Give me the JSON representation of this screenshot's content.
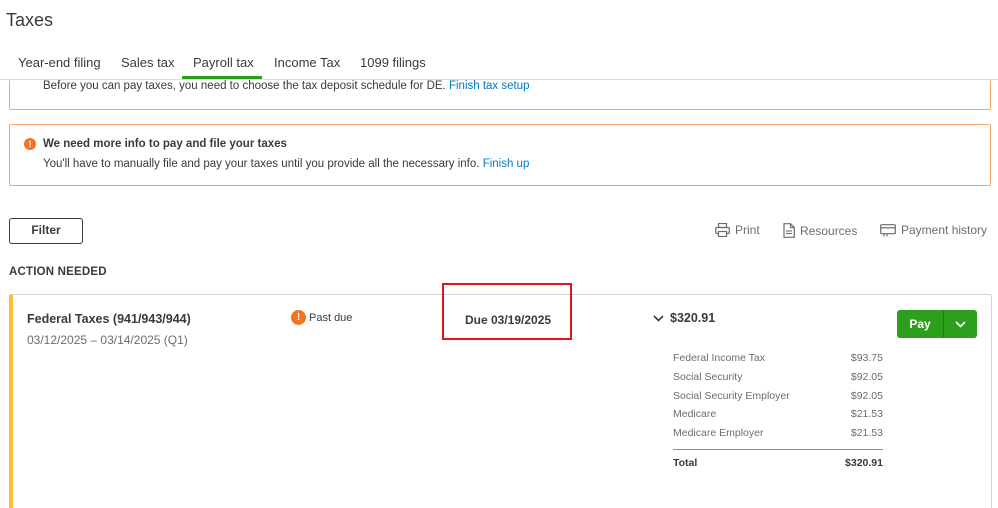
{
  "page": {
    "title": "Taxes"
  },
  "tabs": [
    {
      "label": "Year-end filing"
    },
    {
      "label": "Sales tax"
    },
    {
      "label": "Payroll tax"
    },
    {
      "label": "Income Tax"
    },
    {
      "label": "1099 filings"
    }
  ],
  "active_tab": "Payroll tax",
  "banner_deposit": {
    "text": "Before you can pay taxes, you need to choose the tax deposit schedule for DE.",
    "link": "Finish tax setup"
  },
  "banner_info": {
    "title": "We need more info to pay and file your taxes",
    "text": "You'll have to manually file and pay your taxes until you provide all the necessary info.",
    "link": "Finish up"
  },
  "toolbar": {
    "filter_label": "Filter",
    "print_label": "Print",
    "resources_label": "Resources",
    "payment_history_label": "Payment history"
  },
  "section": {
    "label": "ACTION NEEDED"
  },
  "card": {
    "title": "Federal Taxes (941/943/944)",
    "period": "03/12/2025 – 03/14/2025 (Q1)",
    "status": "Past due",
    "due": "Due 03/19/2025",
    "amount": "$320.91",
    "pay_label": "Pay",
    "breakdown": [
      {
        "label": "Federal Income Tax",
        "value": "$93.75"
      },
      {
        "label": "Social Security",
        "value": "$92.05"
      },
      {
        "label": "Social Security Employer",
        "value": "$92.05"
      },
      {
        "label": "Medicare",
        "value": "$21.53"
      },
      {
        "label": "Medicare Employer",
        "value": "$21.53"
      }
    ],
    "total_label": "Total",
    "total_value": "$320.91"
  },
  "colors": {
    "accent_green": "#2ca01c",
    "warning_orange": "#f4731f",
    "banner_border": "#f2a46b",
    "card_accent": "#ffbb33",
    "highlight_red": "#e0141e",
    "link_blue": "#0077c5"
  },
  "icons": [
    "warning-icon",
    "print-icon",
    "document-icon",
    "payment-history-icon",
    "chevron-down-icon"
  ]
}
